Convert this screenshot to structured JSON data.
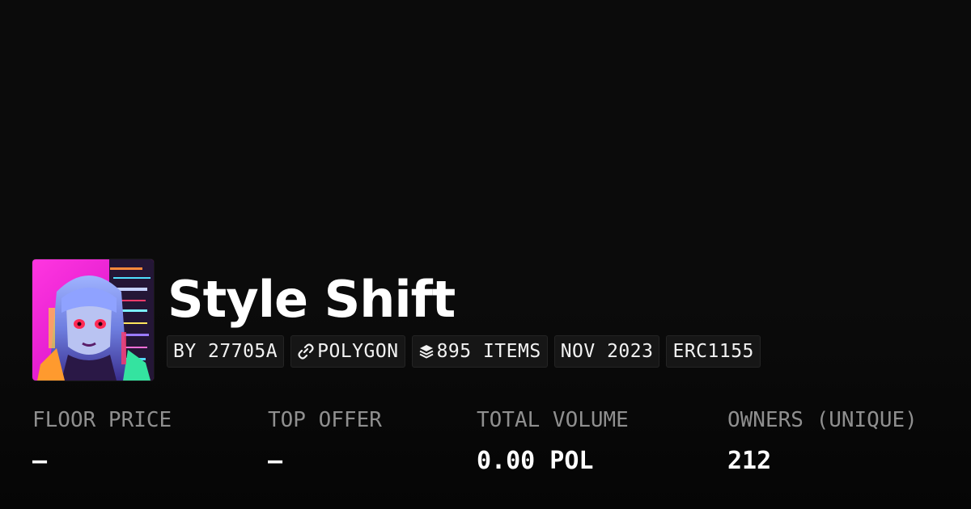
{
  "collection": {
    "title": "Style Shift",
    "badges": {
      "creator": "BY 27705A",
      "chain": "POLYGON",
      "items": "895 ITEMS",
      "date": "NOV 2023",
      "standard": "ERC1155"
    },
    "icons": {
      "chain": "polygon-link-icon",
      "items": "layers-stack-icon"
    }
  },
  "stats": {
    "floor_price": {
      "label": "FLOOR PRICE",
      "value": "—"
    },
    "top_offer": {
      "label": "TOP OFFER",
      "value": "—"
    },
    "total_volume": {
      "label": "TOTAL VOLUME",
      "value": "0.00 POL"
    },
    "owners": {
      "label": "OWNERS (UNIQUE)",
      "value": "212"
    }
  },
  "colors": {
    "background": "#0b0b0b",
    "badge_background": "#161616",
    "label_gray": "#8f8f8f",
    "text_white": "#ffffff",
    "avatar_magenta": "#ff1fd0"
  }
}
